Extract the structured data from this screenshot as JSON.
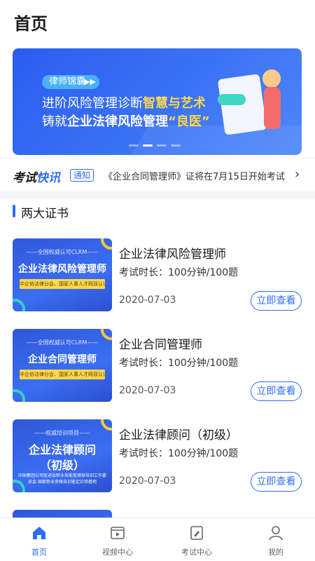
{
  "header": {
    "title": "首页"
  },
  "banner": {
    "tag": "律师锦囊",
    "tag_arrow": "▶▶",
    "line1_plain": "进阶风险管理诊断",
    "line1_highlight": "智慧与艺术",
    "line2_plain": "铸就",
    "line2_highlight": "企业法律风险管理",
    "line2_quote": "“良医”",
    "slides": 4,
    "active_slide": 1
  },
  "news": {
    "logo_a": "考试",
    "logo_b": "快讯",
    "badge": "通知",
    "text": "《企业合同管理师》证将在7月15日开始考试",
    "chevron": "›"
  },
  "section": {
    "title": "两大证书"
  },
  "cards": [
    {
      "thumb_sub": "——全国权威认可CLRM——",
      "thumb_main": "企业法律风险管理师",
      "thumb_band": "中企协法律分会、国家人事人才网双认证",
      "title": "企业法律风险管理师",
      "duration": "考试时长：100分钟/100题",
      "date": "2020-07-03",
      "button": "立即查看"
    },
    {
      "thumb_sub": "——全国权威认可CLRM——",
      "thumb_main": "企业合同管理师",
      "thumb_band": "中企协法律分会、国家人事人才网双认证",
      "title": "企业合同管理师",
      "duration": "考试时长：100分钟/100题",
      "date": "2020-07-03",
      "button": "立即查看"
    },
    {
      "thumb_sub": "——权威培训项目——",
      "thumb_main": "企业法律顾问",
      "thumb_main2": "（初级）",
      "thumb_foot": "中国集团公司促进会职业技能管理部培训工作委员会 国家职业资格培训鉴定实验基地",
      "title": "企业法律顾问（初级）",
      "duration": "考试时长：100分钟/100题",
      "date": "2020-07-03",
      "button": "立即查看"
    }
  ],
  "tabbar": {
    "items": [
      {
        "label": "首页",
        "icon": "home-icon",
        "active": true
      },
      {
        "label": "视频中心",
        "icon": "video-icon",
        "active": false
      },
      {
        "label": "考试中心",
        "icon": "exam-icon",
        "active": false
      },
      {
        "label": "我的",
        "icon": "user-icon",
        "active": false
      }
    ]
  },
  "colors": {
    "accent": "#2f6df6",
    "highlight": "#ffd84a",
    "teal": "#34d3c1"
  }
}
